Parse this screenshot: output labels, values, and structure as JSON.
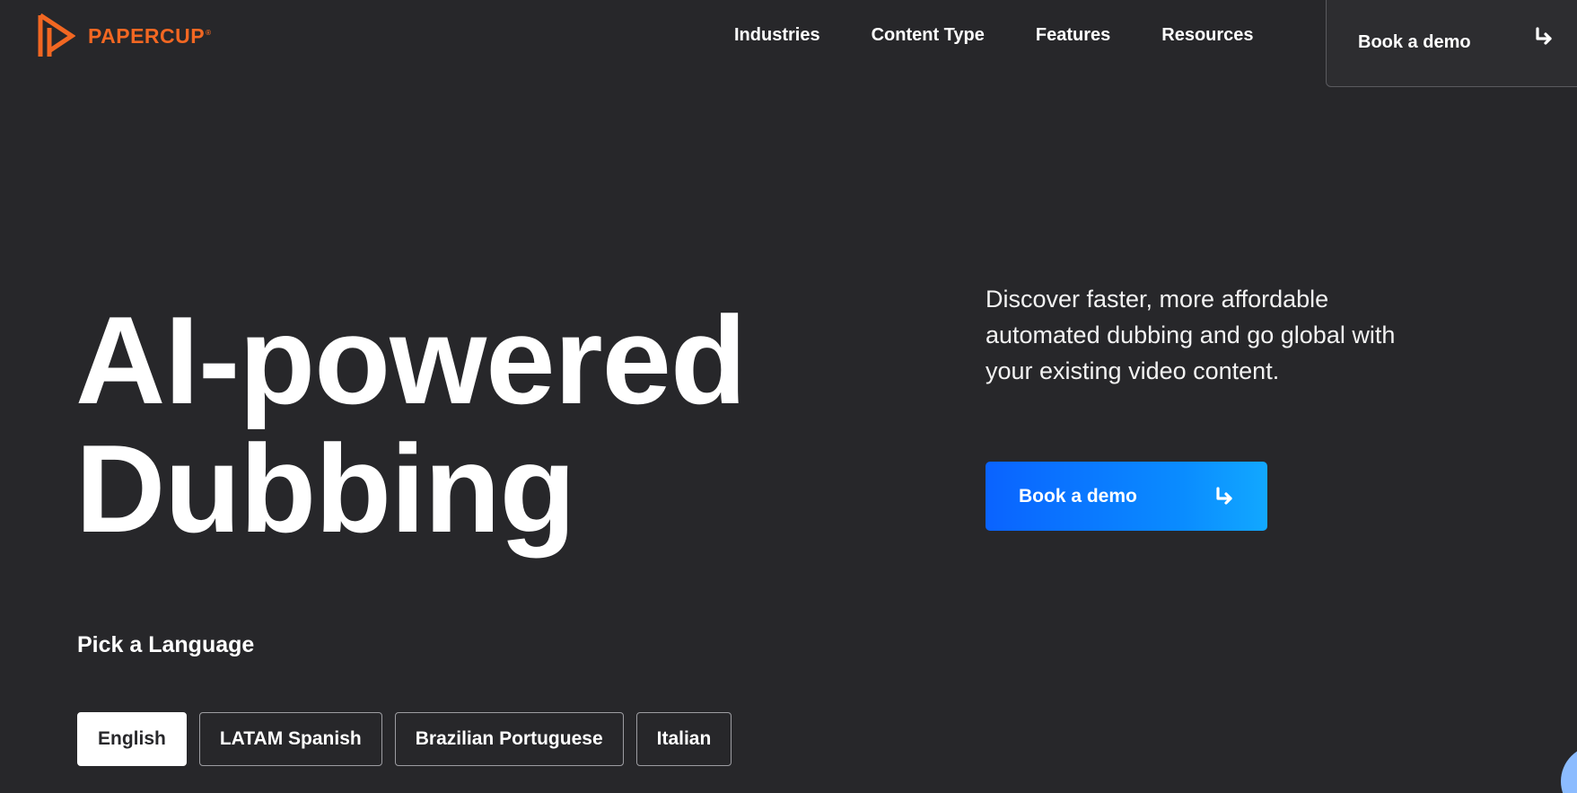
{
  "brand": {
    "name": "PAPERCUP",
    "registered": "®",
    "color": "#f26722"
  },
  "nav": {
    "items": [
      "Industries",
      "Content Type",
      "Features",
      "Resources"
    ],
    "cta_label": "Book a demo",
    "cta_icon": "arrow-turn-down-right-icon"
  },
  "hero": {
    "title_line1": "AI-powered",
    "title_line2": "Dubbing",
    "description": "Discover faster, more affordable automated dubbing and go global with your existing video content.",
    "cta_label": "Book a demo",
    "cta_icon": "arrow-turn-down-right-icon",
    "cta_colors": [
      "#0a63ff",
      "#12a8ff"
    ]
  },
  "languages": {
    "heading": "Pick a Language",
    "options": [
      "English",
      "LATAM Spanish",
      "Brazilian Portuguese",
      "Italian"
    ],
    "selected": "English"
  },
  "colors": {
    "background": "#27272a",
    "text": "#ffffff"
  }
}
